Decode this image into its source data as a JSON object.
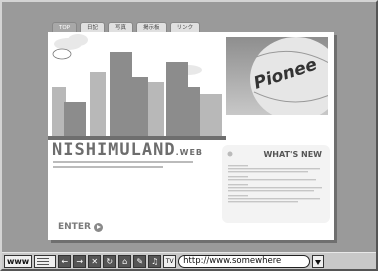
{
  "tabs": [
    {
      "label": "TOP",
      "active": true
    },
    {
      "label": "日記",
      "active": false
    },
    {
      "label": "写真",
      "active": false
    },
    {
      "label": "掲示板",
      "active": false
    },
    {
      "label": "リンク",
      "active": false
    }
  ],
  "hero": {
    "balloon_text": "Pionee"
  },
  "site": {
    "brand": "NISHIMULAND",
    "brand_suffix": ".WEB"
  },
  "news": {
    "title": "WHAT'S NEW"
  },
  "enter": {
    "label": "ENTER"
  },
  "toolbar": {
    "www_label": "www",
    "tv_label": "TV",
    "url": "http://www.somewhere"
  },
  "colors": {
    "page_bg": "#9a9a9a",
    "card_bg": "#ffffff",
    "toolbar_bg": "#c8c8c8"
  }
}
